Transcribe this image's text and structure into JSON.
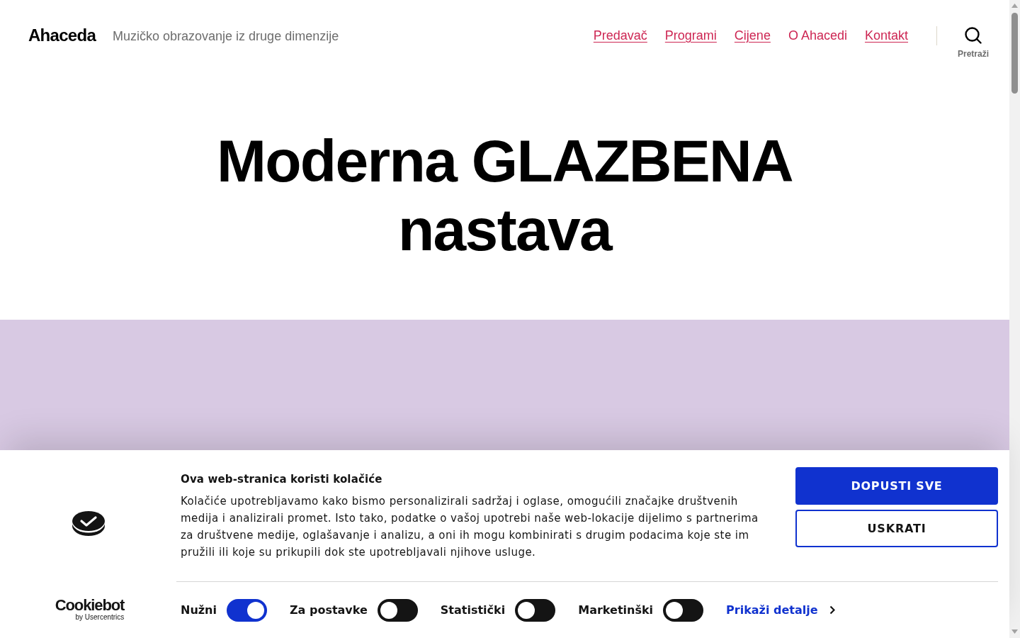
{
  "header": {
    "site_title": "Ahaceda",
    "tagline": "Muzičko obrazovanje iz druge dimenzije",
    "nav": [
      {
        "label": "Predavač",
        "underlined": true
      },
      {
        "label": "Programi",
        "underlined": true
      },
      {
        "label": "Cijene",
        "underlined": true
      },
      {
        "label": "O Ahacedi",
        "underlined": false
      },
      {
        "label": "Kontakt",
        "underlined": true
      }
    ],
    "search": {
      "label": "Pretraži"
    }
  },
  "hero": {
    "title": "Moderna GLAZBENA nastava"
  },
  "cookie_banner": {
    "brand": {
      "name": "Cookiebot",
      "byline": "by Usercentrics"
    },
    "title": "Ova web-stranica koristi kolačiće",
    "text": "Kolačiće upotrebljavamo kako bismo personalizirali sadržaj i oglase, omogućili značajke društvenih medija i analizirali promet. Isto tako, podatke o vašoj upotrebi naše web-lokacije dijelimo s partnerima za društvene medije, oglašavanje i analizu, a oni ih mogu kombinirati s drugim podacima koje ste im pružili ili koje su prikupili dok ste upotrebljavali njihove usluge.",
    "buttons": [
      {
        "label": "DOPUSTI SVE",
        "kind": "primary"
      },
      {
        "label": "USKRATI",
        "kind": "outline"
      }
    ],
    "toggles": [
      {
        "label": "Nužni",
        "on": true
      },
      {
        "label": "Za postavke",
        "on": false
      },
      {
        "label": "Statistički",
        "on": false
      },
      {
        "label": "Marketinški",
        "on": false
      }
    ],
    "details_link": "Prikaži detalje"
  }
}
